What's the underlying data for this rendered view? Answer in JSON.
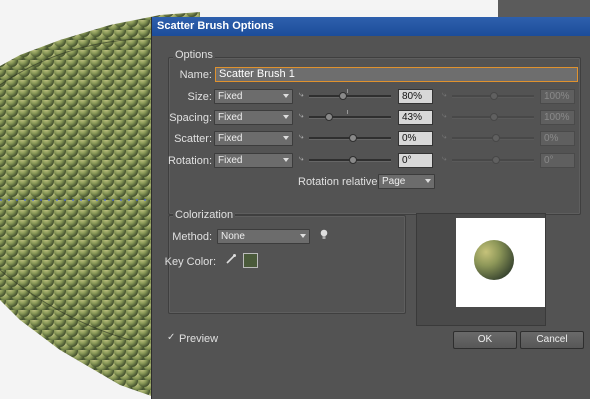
{
  "dialog": {
    "title": "Scatter Brush Options",
    "options_group_label": "Options",
    "name_label": "Name:",
    "name_value": "Scatter Brush 1",
    "rows": [
      {
        "label": "Size:",
        "mode": "Fixed",
        "value1": "80%",
        "value2": "100%",
        "fill": 0.4
      },
      {
        "label": "Spacing:",
        "mode": "Fixed",
        "value1": "43%",
        "value2": "100%",
        "fill": 0.2
      },
      {
        "label": "Scatter:",
        "mode": "Fixed",
        "value1": "0%",
        "value2": "0%",
        "fill": 0.5
      },
      {
        "label": "Rotation:",
        "mode": "Fixed",
        "value1": "0°",
        "value2": "0°",
        "fill": 0.5
      }
    ],
    "rotation_relative_label": "Rotation relative to:",
    "rotation_relative_value": "Page",
    "colorization_group_label": "Colorization",
    "method_label": "Method:",
    "method_value": "None",
    "key_color_label": "Key Color:",
    "key_color_value": "#4a5a3a",
    "preview_label": "Preview",
    "preview_checked": true,
    "ok_label": "OK",
    "cancel_label": "Cancel"
  },
  "colors": {
    "dialog_bg": "#535353",
    "titlebar": "#2456a6",
    "accent_focus": "#e0922e",
    "scale_color": "#8a9a58",
    "selection_dot": "#4060ff"
  }
}
